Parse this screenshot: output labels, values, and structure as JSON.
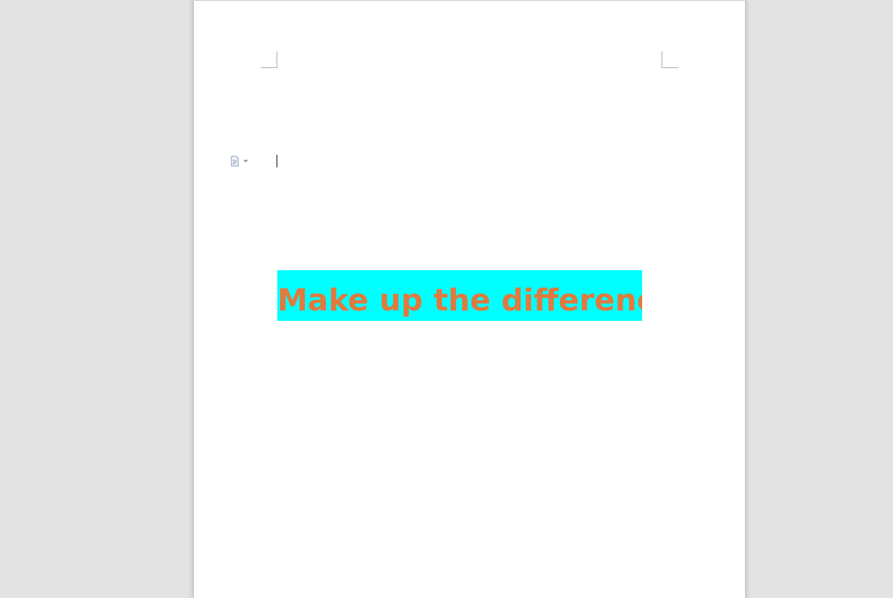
{
  "document": {
    "body_text": "Make up the difference",
    "highlight_color": "#00ffff",
    "text_color": "#e07a3e"
  },
  "icons": {
    "paste_options": "paste-options-icon",
    "dropdown": "chevron-down-icon"
  }
}
